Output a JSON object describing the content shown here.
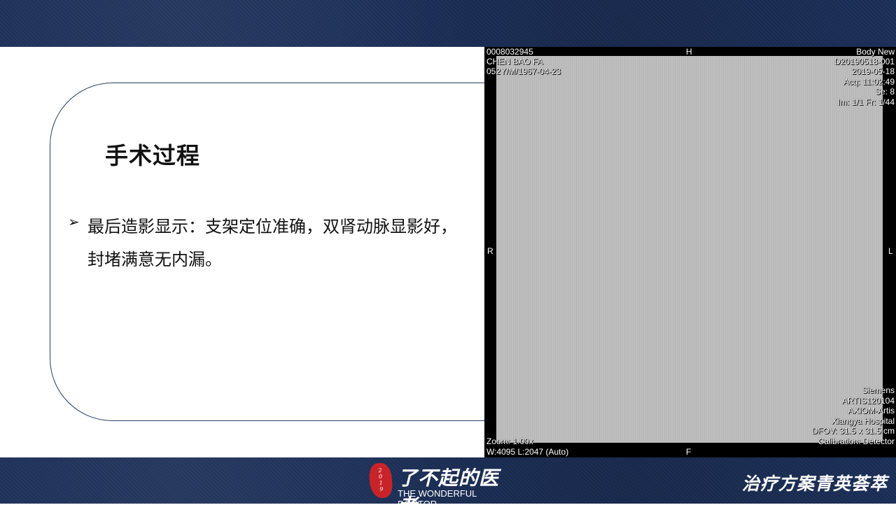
{
  "slide": {
    "title": "手术过程",
    "bullet": "最后造影显示：支架定位准确，双肾动脉显影好，封堵满意无内漏。"
  },
  "xray": {
    "top_left": [
      "0008032945",
      "CHEN BAO FA",
      "052Y/M/1967-04-23"
    ],
    "top_right": [
      "Body New",
      "D20190518-001",
      "2019-05-18",
      "Acq: 11:02:49",
      "Se: 8",
      "Im: 1/1 Fr: 1/44"
    ],
    "bottom_left": [
      "Zoom: 1.00x",
      "W:4095 L:2047 (Auto)"
    ],
    "bottom_right": [
      "Siemens",
      "ARTIS120104",
      "AXIOM-Artis",
      "Xiangya Hospital",
      "DFOV: 31.5 x 31.5 cm",
      "Calibration: Detector"
    ],
    "orient": {
      "top": "H",
      "bottom": "F",
      "left": "R",
      "right": "L"
    }
  },
  "footer": {
    "seal_text": "2019",
    "logo_cn": "了不起的医者",
    "logo_en": "THE WONDERFUL DOCTOR",
    "tagline": "治疗方案青英荟萃"
  },
  "colors": {
    "band": "#1b2e57",
    "card_border": "#2b3e63",
    "seal": "#c9232a"
  },
  "icons": {
    "bullet": "triangle-arrow-icon"
  }
}
